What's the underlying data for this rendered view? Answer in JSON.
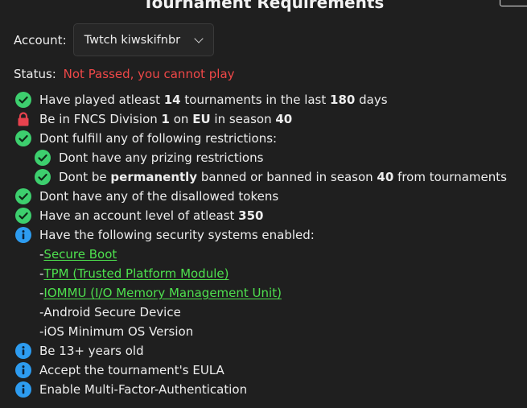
{
  "title": "Tournament Requirements",
  "account": {
    "label": "Account:",
    "selected": "Twtch kiwskifnbr"
  },
  "status": {
    "label": "Status:",
    "value": "Not Passed, you cannot play",
    "color": "#f04848"
  },
  "colors": {
    "check": "#3dcf6e",
    "lock": "#e8424e",
    "info": "#2d9cf0",
    "link": "#4ee14e"
  },
  "requirements": {
    "r1": {
      "icon": "check-icon",
      "a": "Have played atleast ",
      "b": "14",
      "c": " tournaments in the last ",
      "d": "180",
      "e": " days"
    },
    "r2": {
      "icon": "lock-icon",
      "a": "Be in FNCS Division ",
      "b": "1",
      "c": " on ",
      "d": "EU",
      "e": " in season ",
      "f": "40"
    },
    "r3": {
      "icon": "check-icon",
      "text": "Dont fulfill any of following restrictions:"
    },
    "r3a": {
      "icon": "check-icon",
      "text": "Dont have any prizing restrictions"
    },
    "r3b": {
      "icon": "check-icon",
      "a": "Dont be ",
      "b": "permanently",
      "c": " banned or banned in season ",
      "d": "40",
      "e": " from tournaments"
    },
    "r4": {
      "icon": "check-icon",
      "text": "Dont have any of the disallowed tokens"
    },
    "r5": {
      "icon": "check-icon",
      "a": "Have an account level of atleast ",
      "b": "350"
    },
    "r6": {
      "icon": "info-icon",
      "text": "Have the following security systems enabled:"
    },
    "r6_items": [
      {
        "prefix": "- ",
        "text": "Secure Boot",
        "is_link": true
      },
      {
        "prefix": "- ",
        "text": "TPM (Trusted Platform Module)",
        "is_link": true
      },
      {
        "prefix": "- ",
        "text": "IOMMU (I/O Memory Management Unit)",
        "is_link": true
      },
      {
        "prefix": "- ",
        "text": "Android Secure Device",
        "is_link": false
      },
      {
        "prefix": "- ",
        "text": "iOS Minimum OS Version",
        "is_link": false
      }
    ],
    "r7": {
      "icon": "info-icon",
      "text": "Be 13+ years old"
    },
    "r8": {
      "icon": "info-icon",
      "text": "Accept the tournament's EULA"
    },
    "r9": {
      "icon": "info-icon",
      "text": "Enable Multi-Factor-Authentication"
    }
  }
}
